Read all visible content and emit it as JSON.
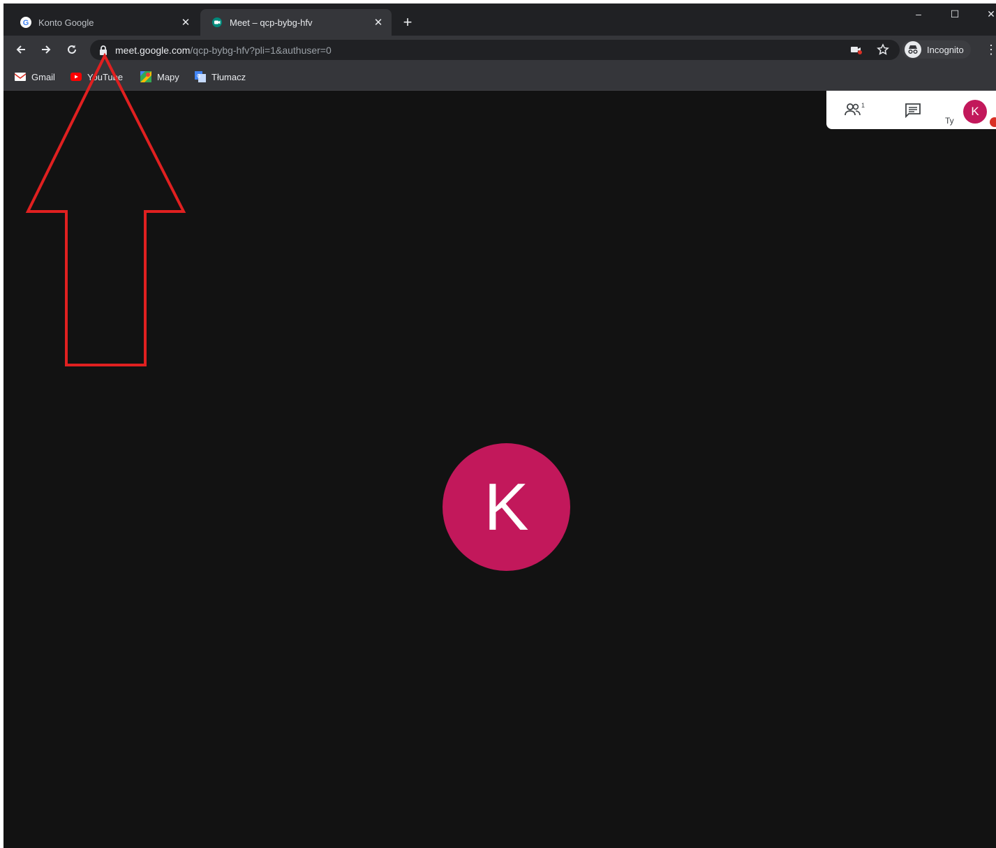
{
  "browser": {
    "tabs": [
      {
        "title": "Konto Google",
        "favicon": "google-g-icon",
        "active": false
      },
      {
        "title": "Meet – qcp-bybg-hfv",
        "favicon": "meet-icon",
        "active": true
      }
    ],
    "new_tab": "+",
    "window_controls": {
      "minimize": "–",
      "maximize": "☐",
      "close": "✕"
    }
  },
  "toolbar": {
    "back": "back-arrow-icon",
    "forward": "forward-arrow-icon",
    "reload": "reload-icon",
    "url_host": "meet.google.com",
    "url_path": "/qcp-bybg-hfv?pli=1&authuser=0",
    "incognito_label": "Incognito"
  },
  "bookmarks": [
    {
      "label": "Gmail",
      "icon": "gmail-icon"
    },
    {
      "label": "YouTube",
      "icon": "youtube-icon"
    },
    {
      "label": "Mapy",
      "icon": "maps-icon"
    },
    {
      "label": "Tłumacz",
      "icon": "translate-icon"
    }
  ],
  "meet": {
    "participants_count": "1",
    "you_label": "Ty",
    "avatar_letter": "K",
    "avatar_color": "#c2185b"
  },
  "annotation": {
    "color": "#e02020"
  }
}
